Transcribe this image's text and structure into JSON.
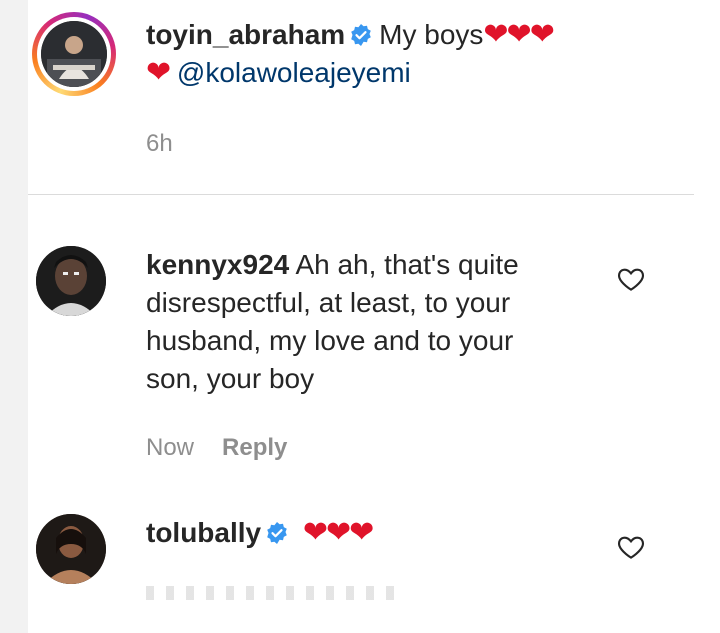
{
  "post": {
    "username": "toyin_abraham",
    "caption_text": "My boys",
    "caption_hearts": "❤❤❤",
    "second_line_heart": "❤",
    "mention": "@kolawoleajeyemi",
    "time": "6h"
  },
  "comments": [
    {
      "username": "kennyx924",
      "text": "Ah ah, that's quite disrespectful, at least, to your husband, my love and to your son, your boy",
      "time": "Now",
      "reply_label": "Reply"
    },
    {
      "username": "tolubally",
      "text": "❤❤❤"
    }
  ],
  "colors": {
    "heart": "#e0132a",
    "verified": "#3897f0",
    "mention": "#00376b",
    "meta": "#8e8e8e"
  },
  "icons": {
    "verified": "verified-badge-icon",
    "like": "heart-outline-icon"
  }
}
